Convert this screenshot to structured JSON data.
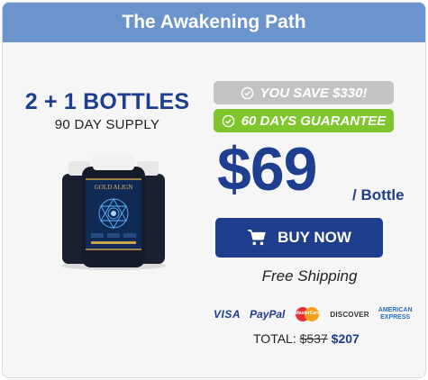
{
  "header": {
    "title": "The Awakening Path"
  },
  "offer": {
    "bottles_label": "2 + 1 BOTTLES",
    "supply_label": "90 DAY SUPPLY",
    "product_brand": "GOLD ALIGN",
    "savings_badge": "YOU SAVE $330!",
    "guarantee_badge": "60 DAYS GUARANTEE",
    "price": "$69",
    "per_unit": "/ Bottle",
    "buy_button_label": "BUY NOW",
    "shipping_label": "Free Shipping",
    "total_label": "TOTAL:",
    "total_original": "$537",
    "total_discounted": "$207"
  },
  "payments": {
    "visa": "VISA",
    "paypal": "PayPal",
    "mastercard": "MasterCard",
    "discover": "DISCOVER",
    "amex_line1": "AMERICAN",
    "amex_line2": "EXPRESS"
  },
  "colors": {
    "header_bg": "#6b93cc",
    "brand_blue": "#1e3f8f",
    "savings_gray": "#c3c3c3",
    "guarantee_green": "#7ec62c"
  },
  "icons": [
    "check-circle-icon",
    "shopping-cart-icon",
    "product-bottles-image"
  ]
}
